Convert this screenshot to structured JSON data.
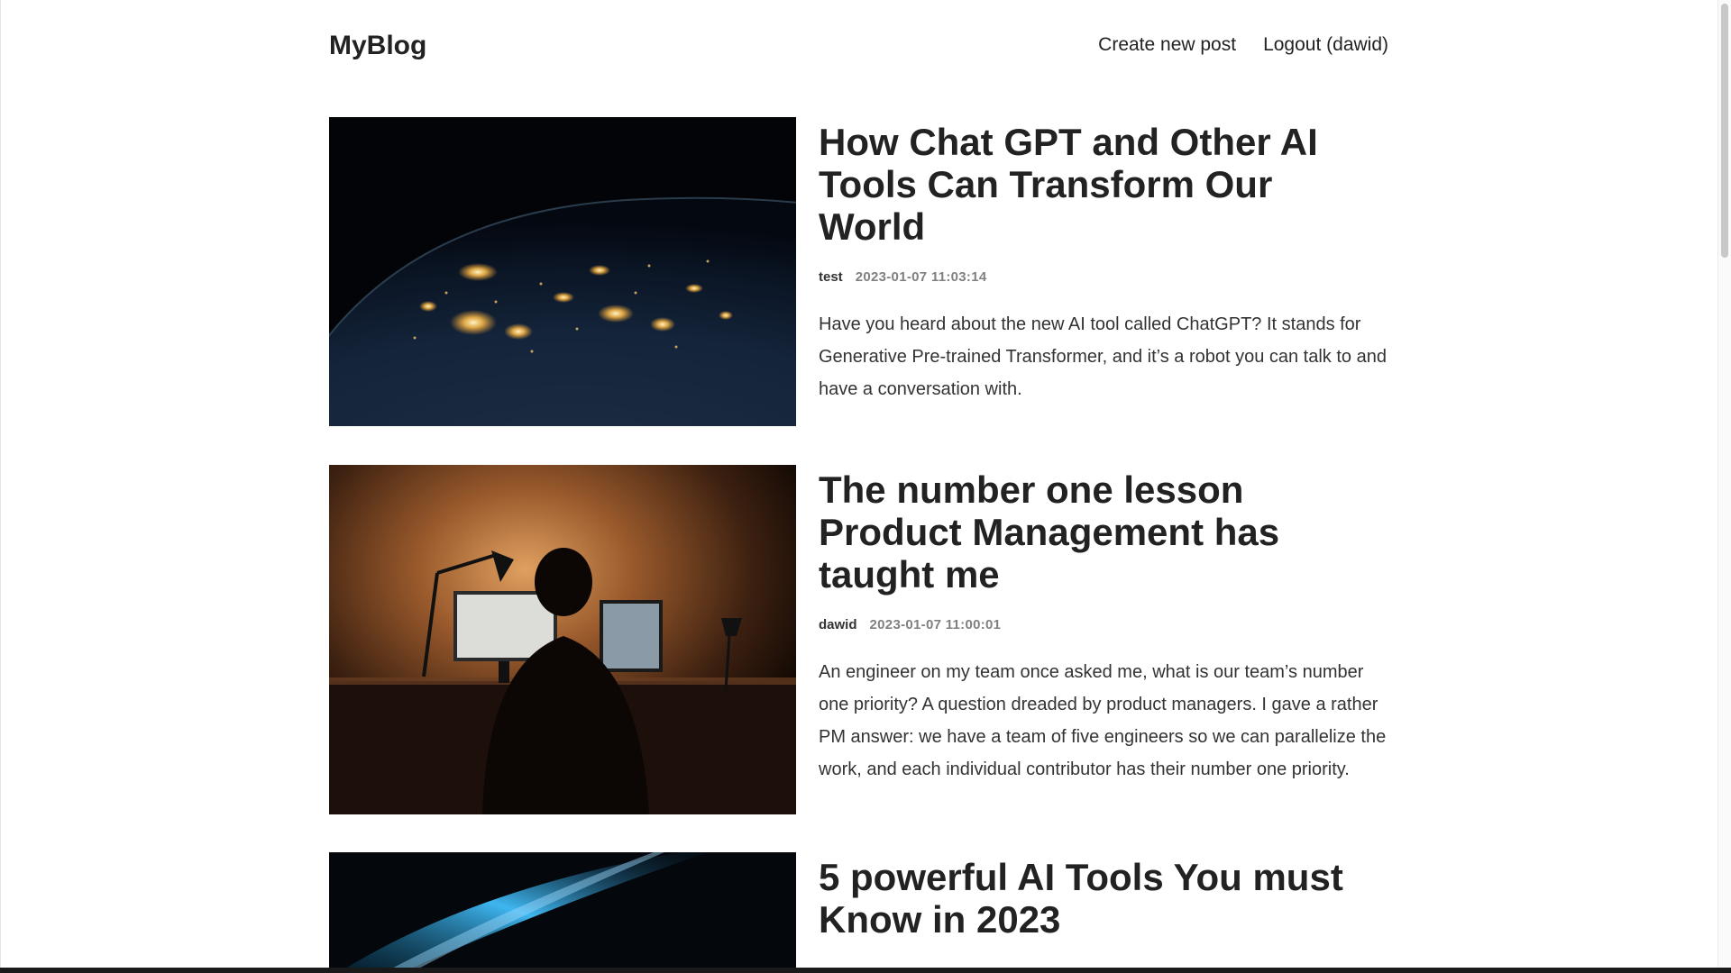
{
  "site": {
    "logo": "MyBlog"
  },
  "nav": {
    "create_post": "Create new post",
    "logout": "Logout (dawid)"
  },
  "posts": [
    {
      "title": "How Chat GPT and Other AI Tools Can Transform Our World",
      "author": "test",
      "date": "2023-01-07 11:03:14",
      "excerpt": "Have you heard about the new AI tool called ChatGPT? It stands for Generative Pre-trained Transformer, and it’s a robot you can talk to and have a conversation with.",
      "image": "earth-at-night-image"
    },
    {
      "title": "The number one lesson Product Management has taught me",
      "author": "dawid",
      "date": "2023-01-07 11:00:01",
      "excerpt": "An engineer on my team once asked me, what is our team’s number one priority? A question dreaded by product managers. I gave a rather PM answer: we have a team of five engineers so we can parallelize the work, and each individual contributor has their number one priority.",
      "image": "person-at-desk-image"
    },
    {
      "title": "5 powerful AI Tools You must Know in 2023",
      "author": "",
      "date": "",
      "excerpt": "",
      "image": "blue-light-streak-image"
    }
  ],
  "colors": {
    "text": "#222222",
    "meta_date": "#808080",
    "background": "#ffffff"
  }
}
